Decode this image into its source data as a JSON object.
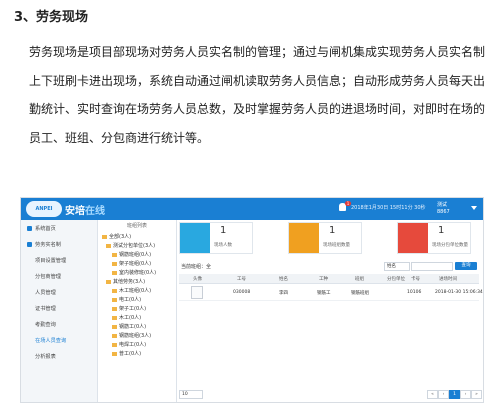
{
  "heading": "3、劳务现场",
  "paragraph": "劳务现场是项目部现场对劳务人员实名制的管理；通过与闸机集成实现劳务人员实名制上下班刷卡进出现场，系统自动通过闸机读取劳务人员信息；自动形成劳务人员每天出勤统计、实时查询在场劳务人员总数，及时掌握劳务人员的进退场时间，对即时在场的员工、班组、分包商进行统计等。",
  "screenshot": {
    "brand_main": "安培",
    "brand_sub": "在线",
    "datetime": "2018年1月30日 15时11分 30秒",
    "badge": "1",
    "user_line1": "测试",
    "user_line2": "8867",
    "sidebar": [
      {
        "label": "系统首页"
      },
      {
        "label": "劳务实名制"
      },
      {
        "label": "项目设置管理"
      },
      {
        "label": "分包商管理"
      },
      {
        "label": "人员管理"
      },
      {
        "label": "证书管理"
      },
      {
        "label": "考勤查询"
      },
      {
        "label": "在场人员查询"
      },
      {
        "label": "分析报表"
      }
    ],
    "tree_title": "班组列表",
    "tree": [
      {
        "label": "全部(3人)"
      },
      {
        "label": "测试分包单位(3人)"
      },
      {
        "label": "钢筋班组(0人)"
      },
      {
        "label": "架子班组(0人)"
      },
      {
        "label": "室内装修班(0人)"
      },
      {
        "label": "其他劳务(3人)"
      },
      {
        "label": "木工班组(0人)"
      },
      {
        "label": "电工(0人)"
      },
      {
        "label": "架子工(0人)"
      },
      {
        "label": "木工(0人)"
      },
      {
        "label": "钢筋工(0人)"
      },
      {
        "label": "钢筋班组(3人)"
      },
      {
        "label": "电焊工(0人)"
      },
      {
        "label": "普工(0人)"
      }
    ],
    "stats": [
      {
        "value": "1",
        "label": "现场人数",
        "color": "#29a8e0"
      },
      {
        "value": "1",
        "label": "现场班组数量",
        "color": "#f0a020"
      },
      {
        "value": "1",
        "label": "现场分包单位数量",
        "color": "#e64a3c"
      }
    ],
    "filter_label": "当前班组：全",
    "filter_select": "姓名",
    "filter_button": "查询",
    "columns": [
      "头像",
      "工号",
      "姓名",
      "工种",
      "班组",
      "分包单位",
      "卡号",
      "进场时间"
    ],
    "rows": [
      [
        "",
        "030008",
        "李四",
        "钢筋工",
        "钢筋班组",
        "",
        "10106",
        "2018-01-30 15:06:34"
      ]
    ],
    "page_size": "10",
    "pages": [
      "«",
      "‹",
      "1",
      "›",
      "»"
    ]
  }
}
